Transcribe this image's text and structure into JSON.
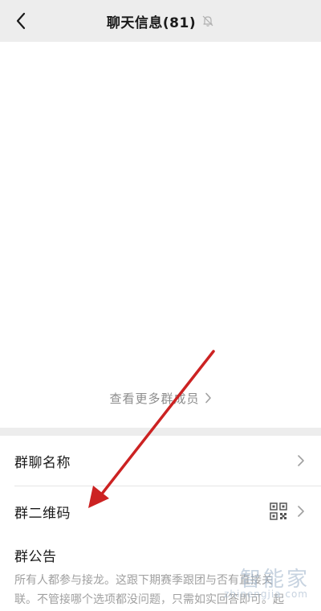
{
  "header": {
    "title": "聊天信息(81)"
  },
  "members": {
    "more_label": "查看更多群成员"
  },
  "settings": {
    "group_name_label": "群聊名称",
    "qr_code_label": "群二维码",
    "announcement_label": "群公告",
    "announcement_text": "所有人都参与接龙。这跟下期赛季跟团与否有直接关联。不管接哪个选项都没问题，只需如实回答即可。起码态度上没问题，没工不用就去冷"
  },
  "watermark": {
    "text": "智能家",
    "url": "zhinengjia.com"
  },
  "colors": {
    "header_bg": "#ededed",
    "annotation_arrow": "#cc2222"
  }
}
